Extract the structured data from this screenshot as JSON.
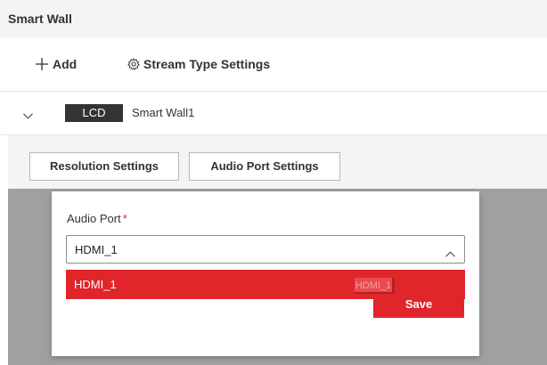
{
  "header": {
    "title": "Smart Wall"
  },
  "toolbar": {
    "add_label": "Add",
    "add_icon": "plus-icon",
    "stream_label": "Stream Type Settings",
    "stream_icon": "gear-icon"
  },
  "wall": {
    "expand_icon": "chevron-down-icon",
    "badge": "LCD",
    "name": "Smart Wall1"
  },
  "settings_tabs": {
    "resolution": "Resolution Settings",
    "audio_port": "Audio Port Settings"
  },
  "modal": {
    "field_label": "Audio Port",
    "required_mark": "*",
    "selected_value": "HDMI_1",
    "options": [
      "HDMI_1"
    ],
    "drag_ghost_text": "HDMI_1",
    "save_label": "Save"
  },
  "colors": {
    "accent": "#e0252b",
    "badge_bg": "#333333",
    "header_bg": "#f3f4f6",
    "backdrop": "#a0a0a0"
  }
}
